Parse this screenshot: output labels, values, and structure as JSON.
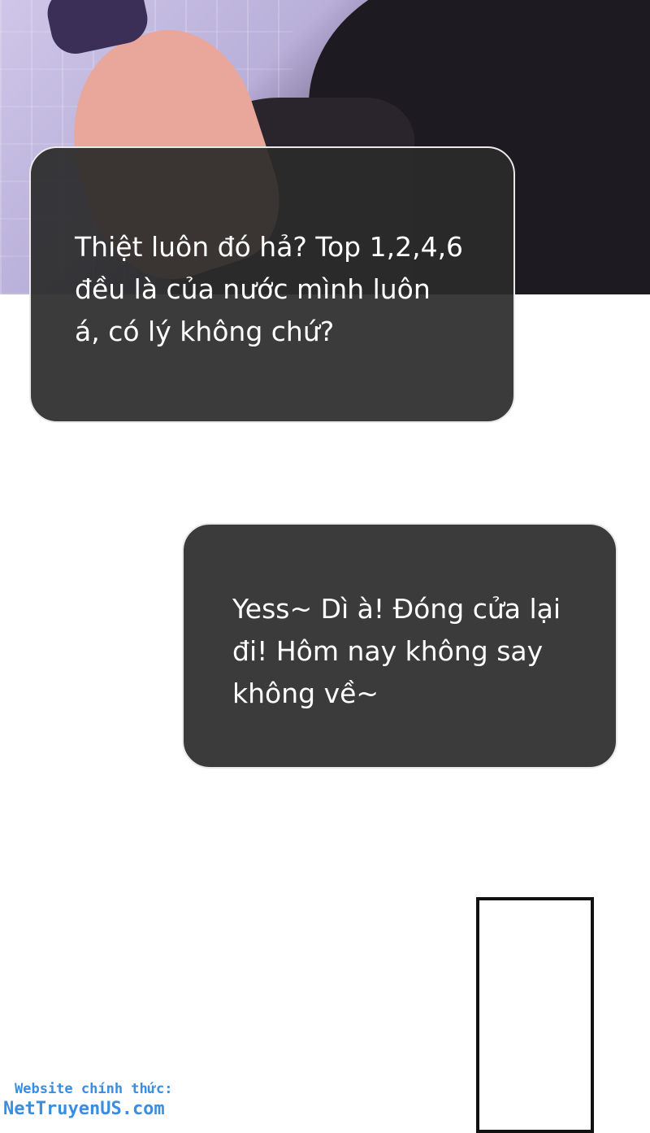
{
  "bubbles": [
    {
      "text": "Thiệt luôn đó hả? Top 1,2,4,6\nđều là của nước mình luôn\ná, có lý không chứ?"
    },
    {
      "text": "Yess~ Dì à! Đóng cửa lại\nđi! Hôm nay không say\nkhông về~"
    }
  ],
  "watermark": {
    "line1": "Website chính thức:",
    "line2": "NetTruyenUS.com"
  },
  "colors": {
    "bubble_fill": "#2a2a2a",
    "bubble_text": "#ffffff",
    "watermark": "#3a8de0"
  }
}
